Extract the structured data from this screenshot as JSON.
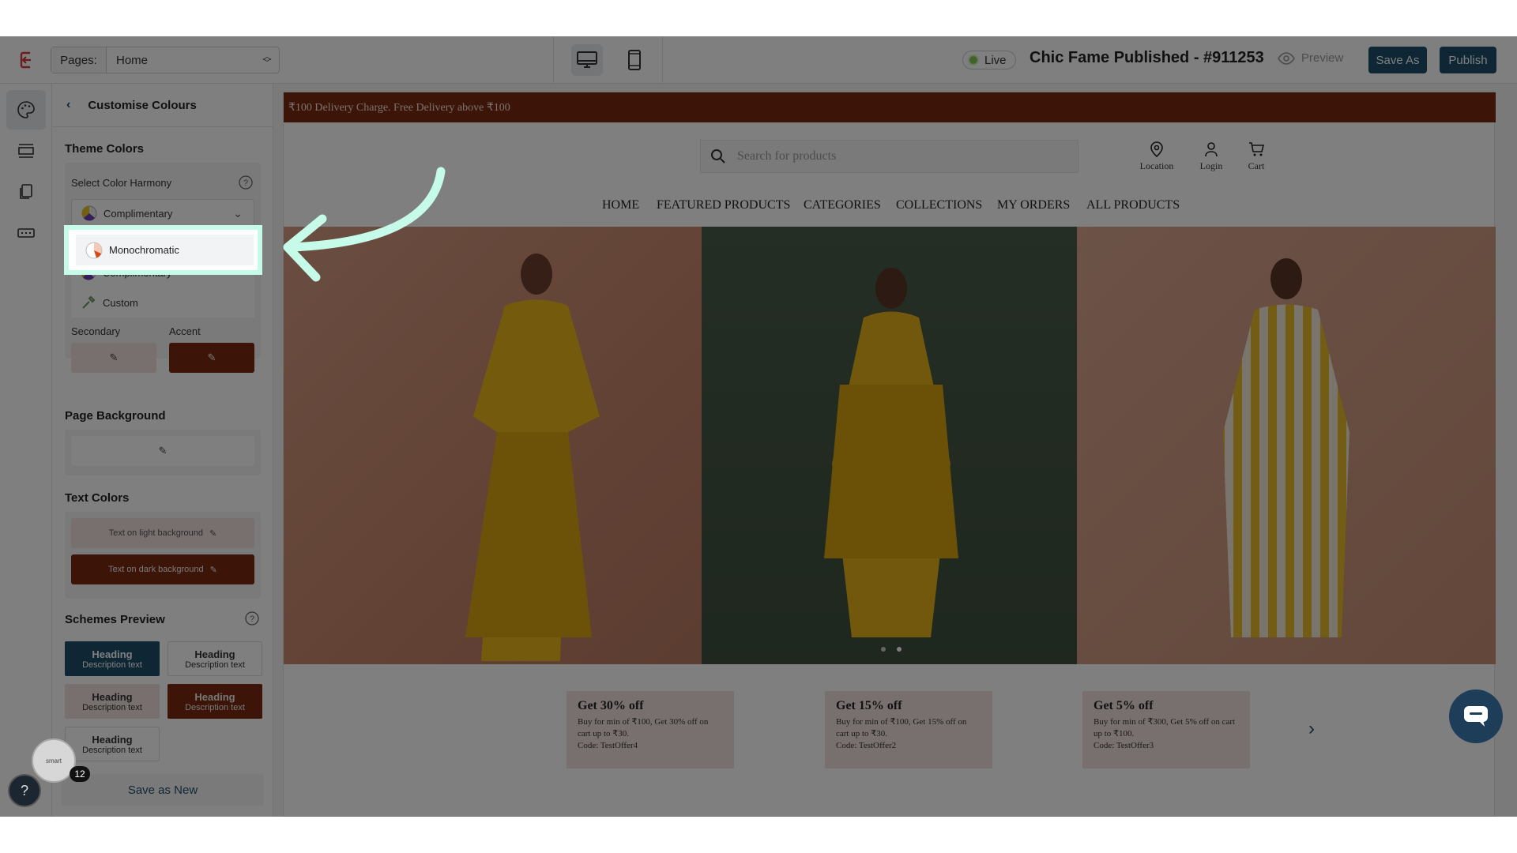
{
  "topbar": {
    "pages_label": "Pages:",
    "pages_value": "Home",
    "live_label": "Live",
    "title": "Chic Fame Published - #911253",
    "preview_label": "Preview",
    "save_as_label": "Save As",
    "publish_label": "Publish"
  },
  "panel": {
    "title": "Customise Colours",
    "theme_colors": "Theme Colors",
    "harmony_label": "Select Color Harmony",
    "harmony_selected": "Complimentary",
    "harmony_options": [
      "Monochromatic",
      "Complimentary",
      "Custom"
    ],
    "secondary_label": "Secondary",
    "accent_label": "Accent",
    "page_background": "Page Background",
    "text_colors": "Text Colors",
    "text_light": "Text on light background",
    "text_dark": "Text on dark background",
    "schemes_preview": "Schemes Preview",
    "scheme_heading": "Heading",
    "scheme_desc": "Description text",
    "save_as_new": "Save as New",
    "badge_count": "12",
    "badge_text": "smart"
  },
  "colors": {
    "accent": "#7a2a10",
    "primary": "#1f4e6b",
    "secondary": "#efe1dc",
    "highlight": "#c6fbe9"
  },
  "store": {
    "announcement": "₹100 Delivery Charge. Free Delivery above ₹100",
    "search_placeholder": "Search for products",
    "location": "Location",
    "login": "Login",
    "cart": "Cart",
    "nav": [
      "HOME",
      "FEATURED PRODUCTS",
      "CATEGORIES",
      "COLLECTIONS",
      "MY ORDERS",
      "ALL PRODUCTS"
    ],
    "offers": [
      {
        "title": "Get 30% off",
        "desc": "Buy for min of ₹100, Get 30% off on cart up to ₹30.",
        "code": "Code: TestOffer4"
      },
      {
        "title": "Get 15% off",
        "desc": "Buy for min of ₹100, Get 15% off on cart up to ₹30.",
        "code": "Code: TestOffer2"
      },
      {
        "title": "Get 5% off",
        "desc": "Buy for min of ₹300, Get 5% off on cart up to ₹100.",
        "code": "Code: TestOffer3"
      }
    ]
  }
}
